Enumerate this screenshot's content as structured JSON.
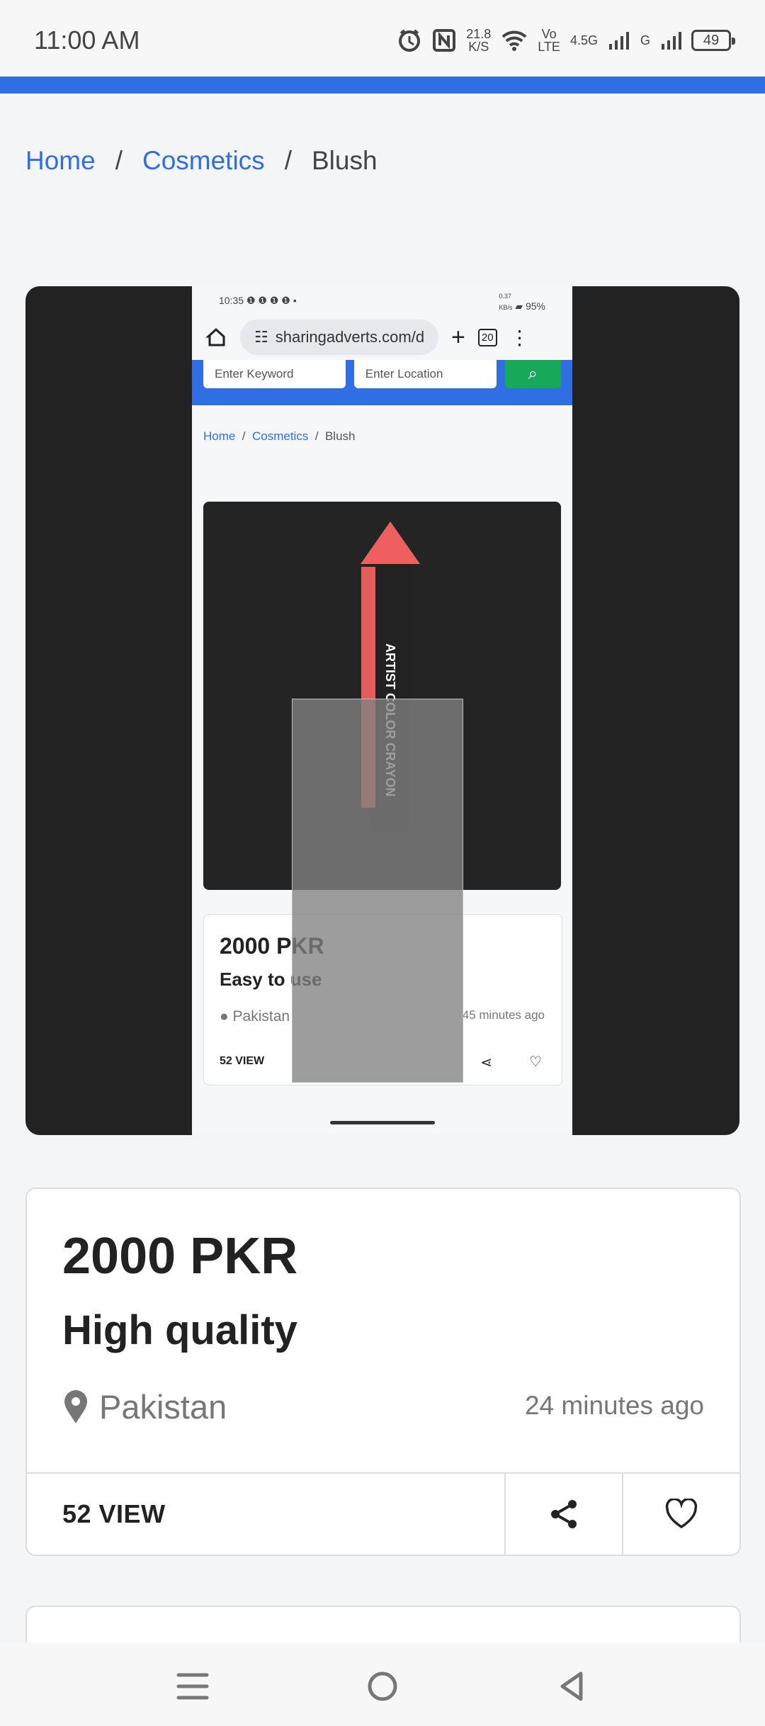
{
  "status_bar": {
    "time": "11:00 AM",
    "network_speed_value": "21.8",
    "network_speed_unit": "K/S",
    "volte": "Vo\nLTE",
    "network_type": "4.5G",
    "second_network": "G",
    "battery": "49"
  },
  "breadcrumb": {
    "items": [
      "Home",
      "Cosmetics",
      "Blush"
    ],
    "separator": "/"
  },
  "embedded_screenshot": {
    "time": "10:35",
    "social_indicators": "❶ ❶ ❶ ❶ •",
    "network_speed": "0.37\nKB/s",
    "battery": "95%",
    "url": "sharingadverts.com/d",
    "tabs_count": "20",
    "keyword_placeholder": "Enter Keyword",
    "location_placeholder": "Enter Location",
    "breadcrumb": [
      "Home",
      "Cosmetics",
      "Blush"
    ],
    "product_text": "ARTIST COLOR CRAYON",
    "price": "2000 PKR",
    "title": "Easy to use",
    "location": "Pakistan",
    "time_ago": "45 minutes ago",
    "views": "52 VIEW"
  },
  "listing": {
    "price": "2000 PKR",
    "title": "High quality",
    "location": "Pakistan",
    "time_ago": "24 minutes ago",
    "views": "52 VIEW"
  },
  "colors": {
    "accent": "#2f6fe3",
    "search_button": "#18a85a",
    "text": "#222222",
    "muted": "#777777"
  },
  "icons": [
    "alarm-icon",
    "nfc-icon",
    "wifi-icon",
    "signal-icon",
    "battery-icon",
    "share-icon",
    "heart-icon",
    "location-pin-icon",
    "menu-icon",
    "home-circle-icon",
    "back-icon"
  ]
}
